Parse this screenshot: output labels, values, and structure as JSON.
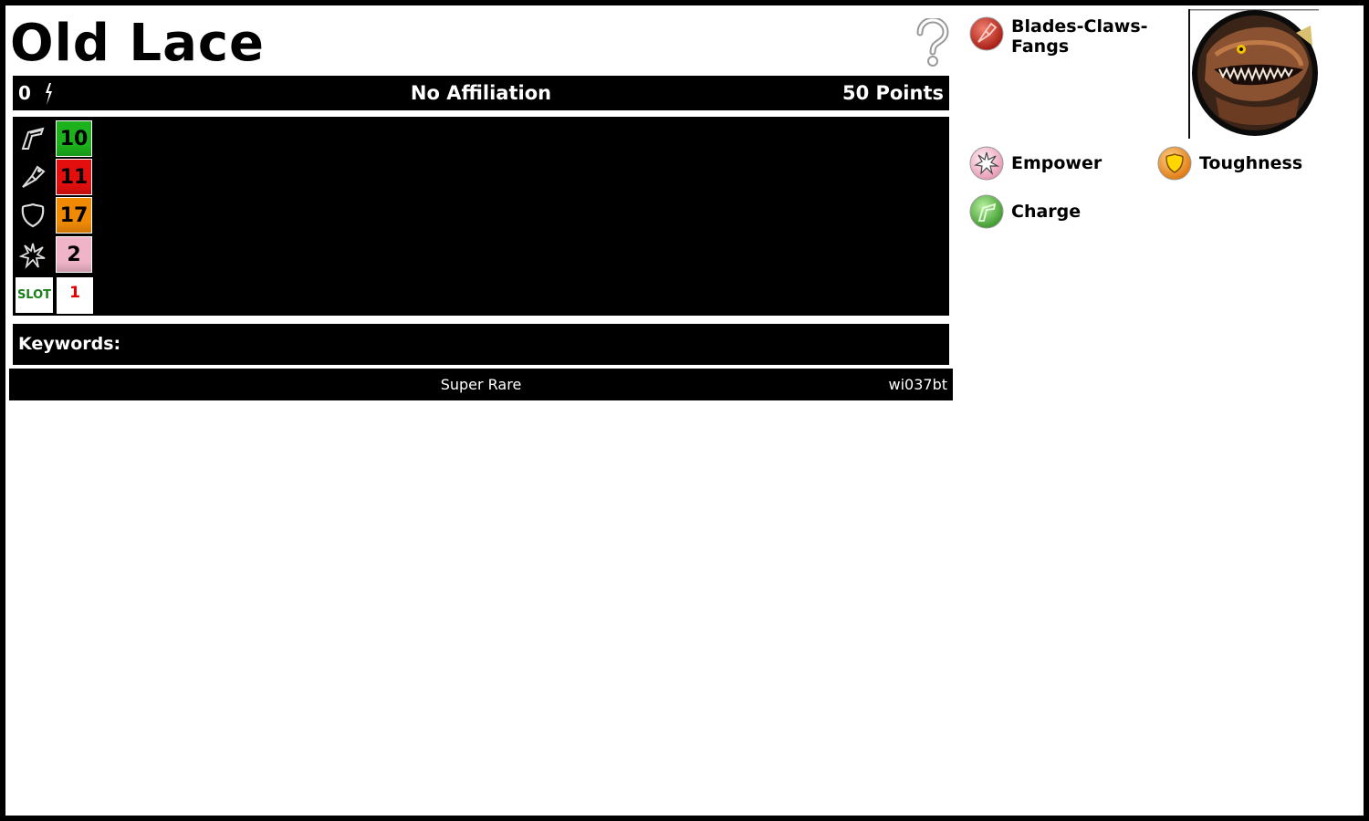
{
  "character": {
    "name": "Old Lace",
    "affiliation": "No Affiliation",
    "cost_left": "0",
    "points": "50 Points"
  },
  "dial": {
    "stats": [
      {
        "icon": "speed-boot-icon",
        "value": "10",
        "color": "#1db11d"
      },
      {
        "icon": "attack-fist-icon",
        "value": "11",
        "color": "#e30f0f"
      },
      {
        "icon": "defense-shield-icon",
        "value": "17",
        "color": "#f08a05"
      },
      {
        "icon": "damage-burst-icon",
        "value": "2",
        "color": "#f0b4c8"
      }
    ],
    "slot_label": "SLOT",
    "slot_value": "1"
  },
  "keywords": {
    "label": "Keywords:"
  },
  "footer": {
    "rarity": "Super Rare",
    "set_code": "wi037bt"
  },
  "powers": [
    {
      "name": "Blades-Claws-\nFangs",
      "line1": "Blades-Claws-",
      "line2": "Fangs",
      "color": "#c83a2a",
      "icon": "blades-claws-fangs-icon"
    },
    {
      "name": "Empower",
      "color": "#f3b6cc",
      "icon": "empower-icon"
    },
    {
      "name": "Toughness",
      "color": "#f29a2c",
      "icon": "toughness-icon"
    },
    {
      "name": "Charge",
      "color": "#55b84a",
      "icon": "charge-icon"
    }
  ]
}
